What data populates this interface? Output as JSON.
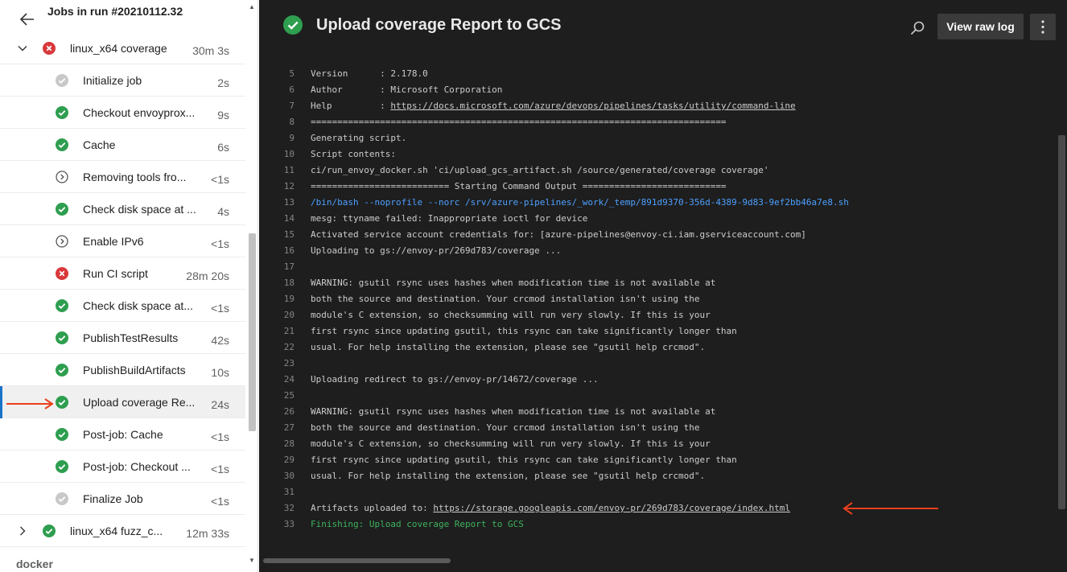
{
  "left": {
    "title": "Jobs in run #20210112.32",
    "rows": [
      {
        "label": "linux_x64 coverage",
        "duration": "30m 3s",
        "status": "failed",
        "level": 0,
        "expand": "expanded"
      },
      {
        "label": "Initialize job",
        "duration": "2s",
        "status": "skipped",
        "level": 1
      },
      {
        "label": "Checkout envoyprox...",
        "duration": "9s",
        "status": "success",
        "level": 1
      },
      {
        "label": "Cache",
        "duration": "6s",
        "status": "success",
        "level": 1
      },
      {
        "label": "Removing tools fro...",
        "duration": "<1s",
        "status": "pending",
        "level": 1
      },
      {
        "label": "Check disk space at ...",
        "duration": "4s",
        "status": "success",
        "level": 1
      },
      {
        "label": "Enable IPv6",
        "duration": "<1s",
        "status": "pending",
        "level": 1
      },
      {
        "label": "Run CI script",
        "duration": "28m 20s",
        "status": "failed",
        "level": 1
      },
      {
        "label": "Check disk space at...",
        "duration": "<1s",
        "status": "success",
        "level": 1
      },
      {
        "label": "PublishTestResults",
        "duration": "42s",
        "status": "success",
        "level": 1
      },
      {
        "label": "PublishBuildArtifacts",
        "duration": "10s",
        "status": "success",
        "level": 1
      },
      {
        "label": "Upload coverage Re...",
        "duration": "24s",
        "status": "success",
        "level": 1,
        "selected": true
      },
      {
        "label": "Post-job: Cache",
        "duration": "<1s",
        "status": "success",
        "level": 1
      },
      {
        "label": "Post-job: Checkout ...",
        "duration": "<1s",
        "status": "success",
        "level": 1
      },
      {
        "label": "Finalize Job",
        "duration": "<1s",
        "status": "skipped",
        "level": 1
      },
      {
        "label": "linux_x64 fuzz_c...",
        "duration": "12m 33s",
        "status": "success",
        "level": 0,
        "expand": "collapsed"
      }
    ],
    "next_group": "docker"
  },
  "right": {
    "title": "Upload coverage Report to GCS",
    "raw_log_label": "View raw log",
    "log_lines": [
      {
        "n": "5",
        "t": "Version      : 2.178.0"
      },
      {
        "n": "6",
        "t": "Author       : Microsoft Corporation"
      },
      {
        "n": "7",
        "pre": "Help         : ",
        "link": "https://docs.microsoft.com/azure/devops/pipelines/tasks/utility/command-line"
      },
      {
        "n": "8",
        "t": "=============================================================================="
      },
      {
        "n": "9",
        "t": "Generating script."
      },
      {
        "n": "10",
        "t": "Script contents:"
      },
      {
        "n": "11",
        "t": "ci/run_envoy_docker.sh 'ci/upload_gcs_artifact.sh /source/generated/coverage coverage'"
      },
      {
        "n": "12",
        "t": "========================== Starting Command Output ==========================="
      },
      {
        "n": "13",
        "t": "/bin/bash --noprofile --norc /srv/azure-pipelines/_work/_temp/891d9370-356d-4389-9d83-9ef2bb46a7e8.sh",
        "style": "cmd"
      },
      {
        "n": "14",
        "t": "mesg: ttyname failed: Inappropriate ioctl for device"
      },
      {
        "n": "15",
        "t": "Activated service account credentials for: [azure-pipelines@envoy-ci.iam.gserviceaccount.com]"
      },
      {
        "n": "16",
        "t": "Uploading to gs://envoy-pr/269d783/coverage ..."
      },
      {
        "n": "17",
        "t": ""
      },
      {
        "n": "18",
        "t": "WARNING: gsutil rsync uses hashes when modification time is not available at"
      },
      {
        "n": "19",
        "t": "both the source and destination. Your crcmod installation isn't using the"
      },
      {
        "n": "20",
        "t": "module's C extension, so checksumming will run very slowly. If this is your"
      },
      {
        "n": "21",
        "t": "first rsync since updating gsutil, this rsync can take significantly longer than"
      },
      {
        "n": "22",
        "t": "usual. For help installing the extension, please see \"gsutil help crcmod\"."
      },
      {
        "n": "23",
        "t": ""
      },
      {
        "n": "24",
        "t": "Uploading redirect to gs://envoy-pr/14672/coverage ..."
      },
      {
        "n": "25",
        "t": ""
      },
      {
        "n": "26",
        "t": "WARNING: gsutil rsync uses hashes when modification time is not available at"
      },
      {
        "n": "27",
        "t": "both the source and destination. Your crcmod installation isn't using the"
      },
      {
        "n": "28",
        "t": "module's C extension, so checksumming will run very slowly. If this is your"
      },
      {
        "n": "29",
        "t": "first rsync since updating gsutil, this rsync can take significantly longer than"
      },
      {
        "n": "30",
        "t": "usual. For help installing the extension, please see \"gsutil help crcmod\"."
      },
      {
        "n": "31",
        "t": ""
      },
      {
        "n": "32",
        "pre": "Artifacts uploaded to: ",
        "link": "https://storage.googleapis.com/envoy-pr/269d783/coverage/index.html"
      },
      {
        "n": "33",
        "t": "Finishing: Upload coverage Report to GCS",
        "style": "finish"
      }
    ]
  },
  "colors": {
    "success": "#2e9e4f",
    "failed": "#d9383a",
    "skipped": "#c8c8c8",
    "annotation_arrow": "#e8401c"
  }
}
